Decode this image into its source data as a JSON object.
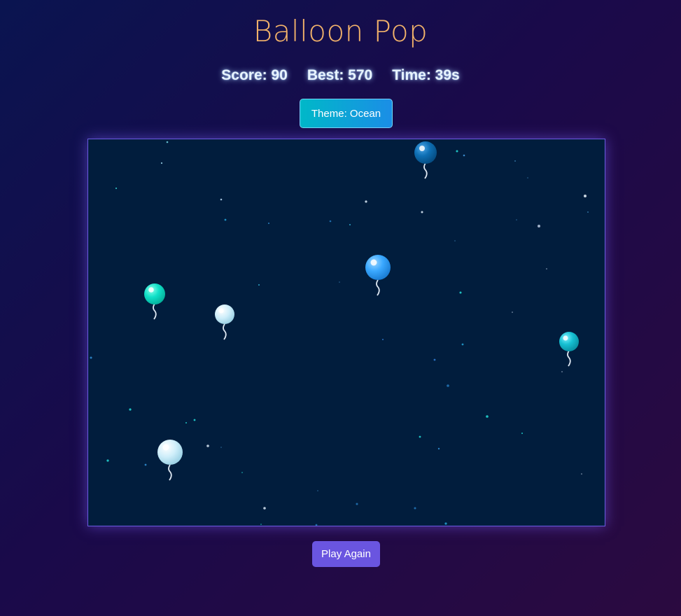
{
  "title": "Balloon Pop",
  "stats": {
    "score": "Score: 90",
    "best": "Best: 570",
    "time": "Time: 39s"
  },
  "theme_button": "Theme: Ocean",
  "play_again_button": "Play Again",
  "colors": {
    "title": "#f3b36a",
    "arena_bg": "#011d3d",
    "arena_border": "#6a5be0",
    "play_button": "#6a55e0"
  },
  "balloon_colors": [
    "#0e6fb4",
    "#3aa8ff",
    "#10e0c8",
    "#cfeefa",
    "#16c0d2",
    "#d6f4fb"
  ],
  "balloon_count": 6
}
